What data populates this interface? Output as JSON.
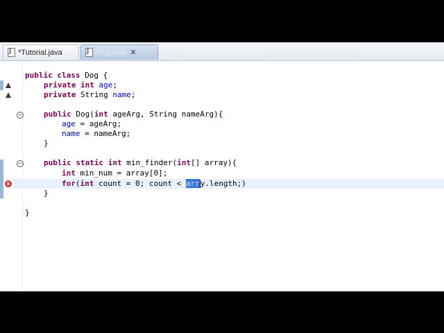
{
  "tabs": [
    {
      "label": "*Tutorial.java",
      "active": false
    },
    {
      "label": "Dog.java",
      "active": true
    }
  ],
  "code": {
    "line1": {
      "k1": "public",
      "k2": "class",
      "rest": " Dog {"
    },
    "line2": {
      "k1": "private",
      "k2": "int",
      "field": "age",
      "end": ";"
    },
    "line3": {
      "k1": "private",
      "type": " String ",
      "field": "name",
      "end": ";"
    },
    "line5": {
      "k1": "public",
      "rest": " Dog(",
      "k2": "int",
      "rest2": " ageArg, String nameArg){"
    },
    "line6": {
      "field": "age",
      "rest": " = ageArg;"
    },
    "line7": {
      "field": "name",
      "rest": " = nameArg;"
    },
    "line8": {
      "rest": "}"
    },
    "line10": {
      "k1": "public",
      "k2": "static",
      "k3": "int",
      "rest": " min_finder(",
      "k4": "int",
      "rest2": "[] array){"
    },
    "line11": {
      "k1": "int",
      "rest": " min_num = array[0];"
    },
    "line12": {
      "k1": "for",
      "rest": "(",
      "k2": "int",
      "rest2": " count = 0; count < ",
      "sel": "arr",
      "after_cursor": "y.length;)"
    },
    "line13": {
      "rest": "}"
    },
    "line15": {
      "rest": "}"
    }
  },
  "colors": {
    "keyword": "#7f0055",
    "field": "#0000c0",
    "selection": "#3875d7",
    "error": "#d63131",
    "current_line": "#e8f2fe"
  },
  "icons": [
    "java-file-icon",
    "close-icon",
    "fold-icon",
    "override-icon",
    "error-icon"
  ]
}
